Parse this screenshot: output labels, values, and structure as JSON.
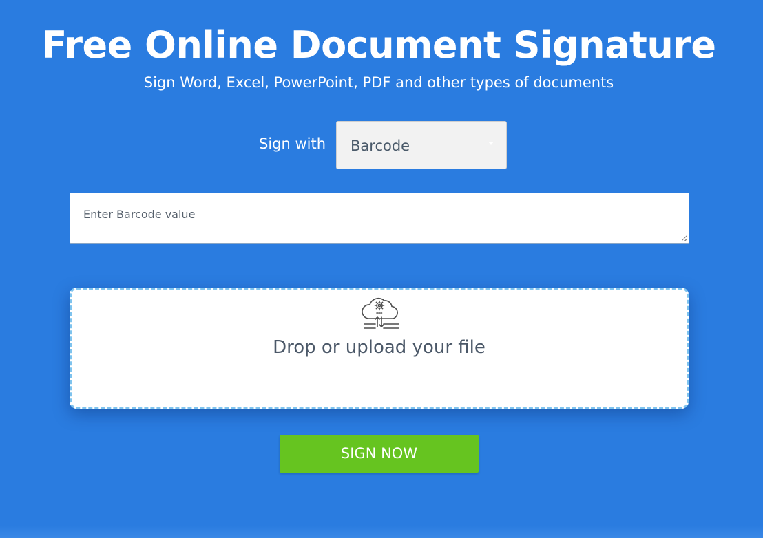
{
  "header": {
    "title": "Free Online Document Signature",
    "subtitle": "Sign Word, Excel, PowerPoint, PDF and other types of documents"
  },
  "sign_with": {
    "label": "Sign with",
    "selected": "Barcode",
    "icon": "chevron-down-icon"
  },
  "barcode_input": {
    "placeholder": "Enter Barcode value",
    "value": ""
  },
  "dropzone": {
    "icon": "cloud-upload-gear-icon",
    "text": "Drop or upload your file"
  },
  "actions": {
    "sign_label": "SIGN NOW"
  },
  "colors": {
    "background": "#2a7ce0",
    "button": "#66c420",
    "dropzone_border": "#7ec3ee"
  }
}
